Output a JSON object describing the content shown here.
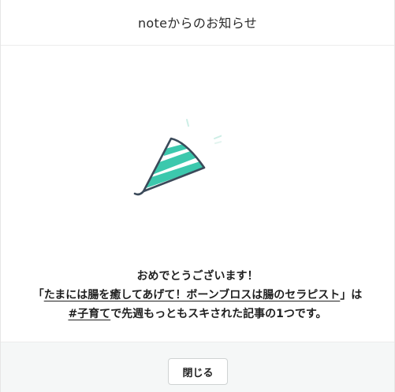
{
  "header": {
    "title": "noteからのお知らせ"
  },
  "illustration": {
    "icon": "party-popper-icon",
    "accent_color": "#3cc8ad",
    "outline_color": "#3b4a5a"
  },
  "message": {
    "line1": "おめでとうございます！",
    "line2_prefix": "「",
    "article_title": "たまには腸を癒してあげて！ボーンブロスは腸のセラピスト",
    "line2_suffix": "」は",
    "hashtag": "#子育て",
    "line3_suffix": "で先週もっともスキされた記事の1つです。"
  },
  "footer": {
    "close_label": "閉じる"
  }
}
